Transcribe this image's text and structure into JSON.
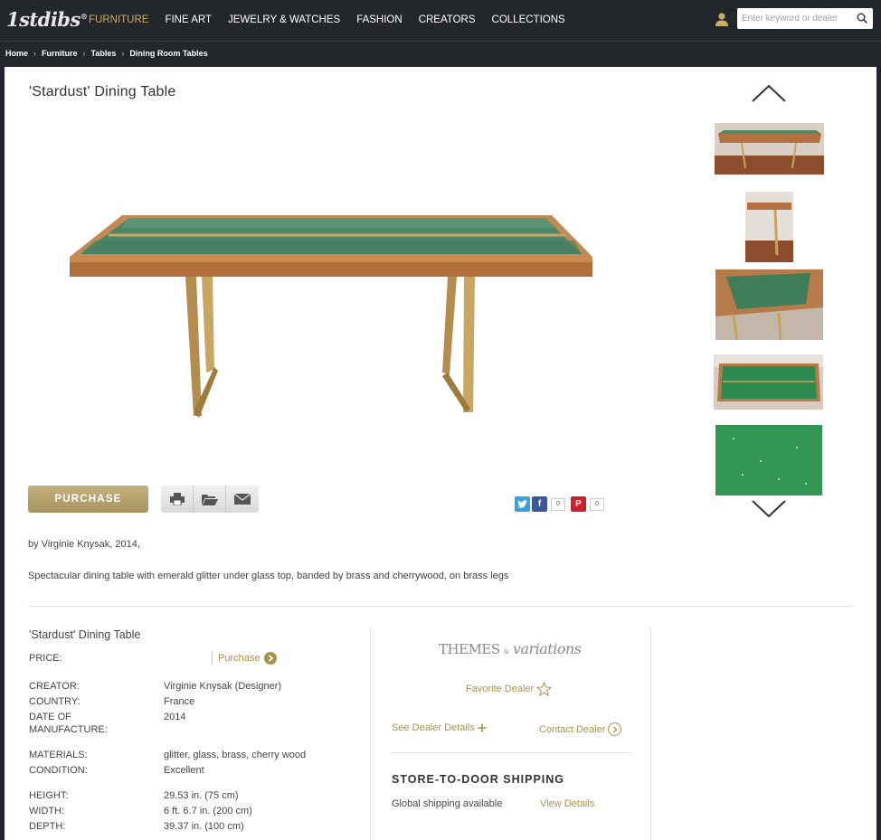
{
  "brand": {
    "logo_text": "1stdibs",
    "logo_mark": "®"
  },
  "nav": {
    "items": [
      {
        "label": "FURNITURE",
        "active": true
      },
      {
        "label": "FINE ART",
        "active": false
      },
      {
        "label": "JEWELRY & WATCHES",
        "active": false
      },
      {
        "label": "FASHION",
        "active": false
      },
      {
        "label": "CREATORS",
        "active": false
      },
      {
        "label": "COLLECTIONS",
        "active": false
      }
    ],
    "search_placeholder": "Enter keyword or dealer"
  },
  "breadcrumb": [
    "Home",
    "Furniture",
    "Tables",
    "Dining Room Tables"
  ],
  "product": {
    "title": "'Stardust' Dining Table",
    "purchase_label": "PURCHASE",
    "byline": "by Virginie Knysak, 2014,",
    "description": "Spectacular dining table with emerald glitter under glass top, banded by brass and cherrywood, on brass legs",
    "social": {
      "pinterest_count": "0",
      "facebook_count": "0"
    }
  },
  "specs": {
    "title": "'Stardust' Dining Table",
    "price_label": "PRICE:",
    "price_link": "Purchase",
    "rows": [
      {
        "label": "CREATOR:",
        "value": "Virginie Knysak (Designer)"
      },
      {
        "label": "COUNTRY:",
        "value": "France"
      },
      {
        "label": "DATE OF",
        "label2": "MANUFACTURE:",
        "value": "2014"
      },
      {
        "label": "MATERIALS:",
        "value": "glitter, glass, brass, cherry wood"
      },
      {
        "label": "CONDITION:",
        "value": "Excellent"
      },
      {
        "label": "HEIGHT:",
        "value": "29.53 in. (75 cm)"
      },
      {
        "label": "WIDTH:",
        "value": "6 ft. 6.7 in. (200 cm)"
      },
      {
        "label": "DEPTH:",
        "value": "39.37 in. (100 cm)"
      }
    ]
  },
  "dealer": {
    "logo_part1": "THEMES",
    "logo_amp": "&",
    "logo_part2": "variations",
    "favorite_label": "Favorite Dealer",
    "see_details_label": "See Dealer Details",
    "contact_label": "Contact Dealer"
  },
  "shipping": {
    "title": "STORE-TO-DOOR SHIPPING",
    "text": "Global shipping available",
    "link": "View Details"
  },
  "colors": {
    "gold": "#a8924f",
    "nav_bg": "#23262b",
    "active_nav": "#c8ad6c"
  }
}
